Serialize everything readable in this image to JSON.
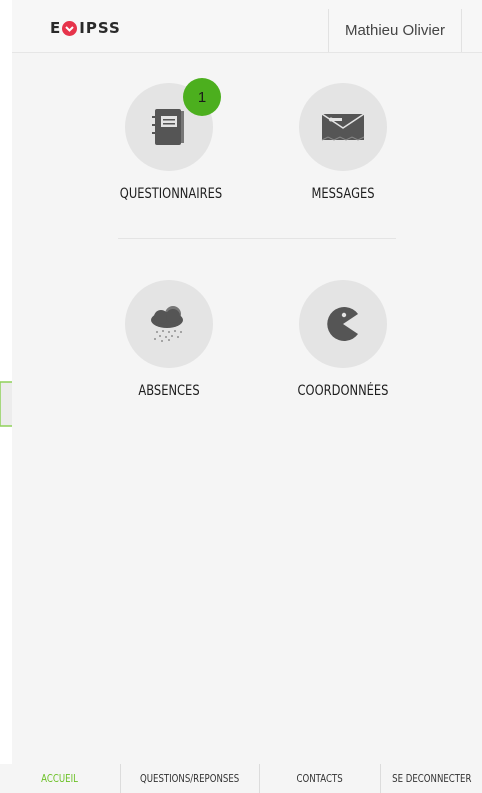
{
  "header": {
    "logo": {
      "before": "E",
      "after": "IPSS",
      "mark_color": "#e6344b"
    },
    "user_name": "Mathieu Olivier"
  },
  "tiles": [
    {
      "label": "QUESTIONNAIRES",
      "icon": "notebook-icon",
      "badge": "1"
    },
    {
      "label": "MESSAGES",
      "icon": "envelope-icon"
    },
    {
      "label": "ABSENCES",
      "icon": "snow-cloud-icon"
    },
    {
      "label": "COORDONNÉES",
      "icon": "pacman-icon"
    }
  ],
  "bottom_nav": {
    "items": [
      {
        "label": "ACCUEIL",
        "active": true
      },
      {
        "label": "QUESTIONS/REPONSES"
      },
      {
        "label": "CONTACTS"
      },
      {
        "label": "SE DECONNECTER"
      }
    ]
  },
  "colors": {
    "accent": "#6cc127",
    "badge": "#4caf1e",
    "logo_mark": "#e6344b",
    "icon": "#555555",
    "tile_circle": "#e4e4e4"
  }
}
